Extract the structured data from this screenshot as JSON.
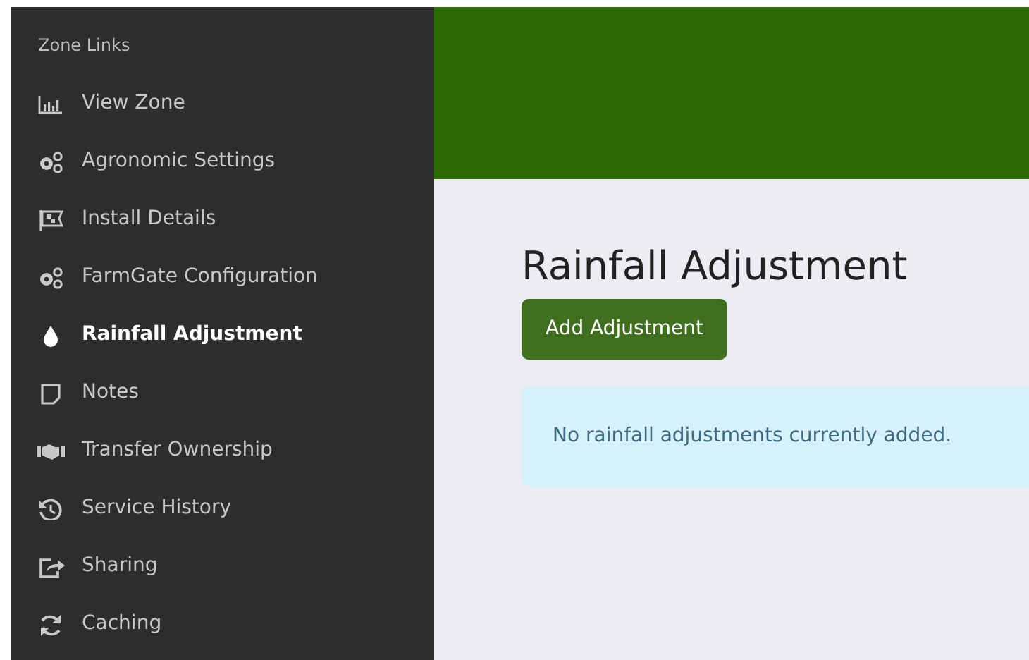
{
  "sidebar": {
    "heading": "Zone Links",
    "items": [
      {
        "label": "View Zone",
        "selected": false
      },
      {
        "label": "Agronomic Settings",
        "selected": false
      },
      {
        "label": "Install Details",
        "selected": false
      },
      {
        "label": "FarmGate Configuration",
        "selected": false
      },
      {
        "label": "Rainfall Adjustment",
        "selected": true
      },
      {
        "label": "Notes",
        "selected": false
      },
      {
        "label": "Transfer Ownership",
        "selected": false
      },
      {
        "label": "Service History",
        "selected": false
      },
      {
        "label": "Sharing",
        "selected": false
      },
      {
        "label": "Caching",
        "selected": false
      }
    ]
  },
  "main": {
    "title": "Rainfall Adjustment",
    "button": "Add Adjustment",
    "alert": "No rainfall adjustments currently added."
  }
}
